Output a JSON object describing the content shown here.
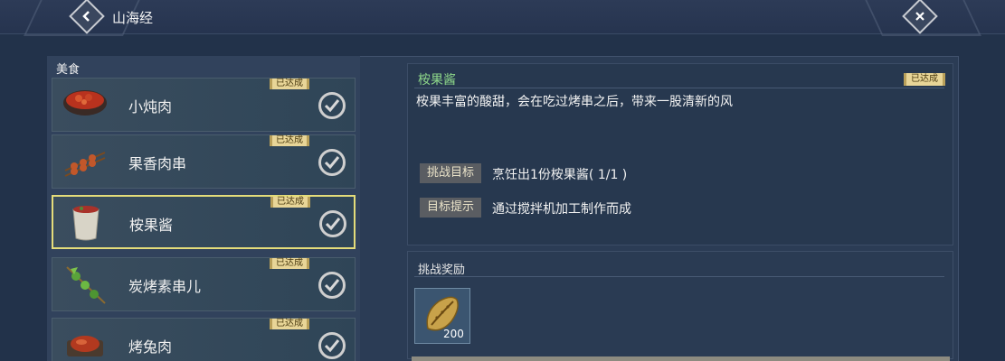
{
  "header": {
    "title": "山海经"
  },
  "sidebar": {
    "category": "美食",
    "items": [
      {
        "name": "小炖肉",
        "badge": "已达成",
        "selected": false
      },
      {
        "name": "果香肉串",
        "badge": "已达成",
        "selected": false
      },
      {
        "name": "桉果酱",
        "badge": "已达成",
        "selected": true
      },
      {
        "name": "炭烤素串儿",
        "badge": "已达成",
        "selected": false
      },
      {
        "name": "烤兔肉",
        "badge": "已达成",
        "selected": false
      }
    ]
  },
  "detail": {
    "title": "桉果酱",
    "badge": "已达成",
    "description": "桉果丰富的酸甜，会在吃过烤串之后，带来一股清新的风",
    "challenge_label": "挑战目标",
    "challenge_value": "烹饪出1份桉果酱( 1/1 )",
    "hint_label": "目标提示",
    "hint_value": "通过搅拌机加工制作而成"
  },
  "reward": {
    "title": "挑战奖励",
    "items": [
      {
        "icon": "seed-pod-icon",
        "quantity": "200"
      }
    ]
  },
  "colors": {
    "accent_green": "#8ed78a",
    "badge_gold": "#e8d597",
    "selected_border": "#e4dc7a"
  }
}
